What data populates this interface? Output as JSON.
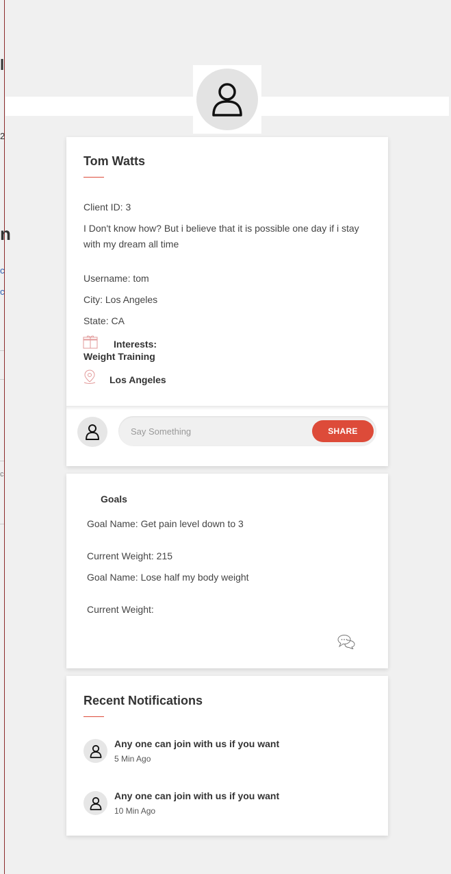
{
  "edge_fragments": [
    "l",
    "2",
    "n",
    "c",
    "c",
    "c"
  ],
  "profile": {
    "name": "Tom Watts",
    "client_id": "Client ID: 3",
    "bio": "I Don't know how? But i believe that it is possible one day if i stay with my dream all time",
    "username": "Username: tom",
    "city": "City: Los Angeles",
    "state": "State: CA",
    "interests_label": "Interests:",
    "interests_value": "Weight Training",
    "location": "Los Angeles"
  },
  "comment": {
    "placeholder": "Say Something",
    "share_label": "SHARE"
  },
  "goals": {
    "title": "Goals",
    "items": [
      "Goal Name: Get pain level down to 3",
      "Current Weight: 215",
      "Goal Name: Lose half my body weight",
      "Current Weight:"
    ]
  },
  "notifications": {
    "title": "Recent Notifications",
    "items": [
      {
        "text": "Any one can join with us if you want",
        "time": "5 Min Ago"
      },
      {
        "text": "Any one can join with us if you want",
        "time": "10 Min Ago"
      }
    ]
  },
  "colors": {
    "accent": "#dd4b39",
    "background": "#f0f0f0",
    "card": "#ffffff"
  },
  "icons": [
    "user-icon",
    "gift-icon",
    "location-pin-icon",
    "chat-bubbles-icon"
  ]
}
